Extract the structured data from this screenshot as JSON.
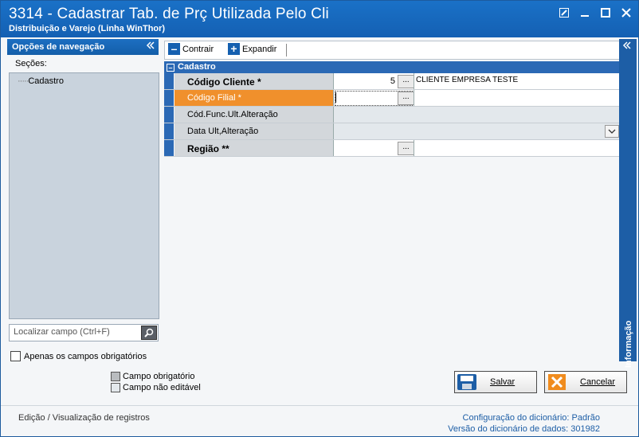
{
  "window": {
    "title": "3314 - Cadastrar Tab. de Prç Utilizada Pelo Cli",
    "subtitle": "Distribuição e Varejo (Linha WinThor)"
  },
  "nav": {
    "header": "Opções de navegação",
    "sections_label": "Seções:",
    "tree": [
      {
        "label": "Cadastro"
      }
    ],
    "search_placeholder": "Localizar campo (Ctrl+F)",
    "only_required_label": "Apenas os campos obrigatórios"
  },
  "legend": {
    "required": "Campo obrigatório",
    "readonly": "Campo não editável"
  },
  "toolbar": {
    "collapse": "Contrair",
    "expand": "Expandir"
  },
  "grid": {
    "category": "Cadastro",
    "rows": [
      {
        "label": "Código Cliente *",
        "value": "5",
        "description": "CLIENTE EMPRESA TESTE"
      },
      {
        "label": "Código Filial *",
        "value": "",
        "description": ""
      },
      {
        "label": "Cód.Func.Ult.Alteração",
        "value": ""
      },
      {
        "label": "Data Ult,Alteração",
        "value": ""
      },
      {
        "label": "Região **",
        "value": "",
        "description": ""
      }
    ]
  },
  "info_panel": {
    "label": "Informação"
  },
  "buttons": {
    "save": "Salvar",
    "cancel": "Cancelar"
  },
  "footer": {
    "mode": "Edição / Visualização de registros",
    "dict_config_label": "Configuração do dicionário:",
    "dict_config_value": "Padrão",
    "dict_version_label": "Versão do dicionário de dados:",
    "dict_version_value": "301982"
  },
  "colors": {
    "title_bar": "#1a71c7",
    "selected_row": "#f0902c",
    "category": "#2b69b5"
  }
}
